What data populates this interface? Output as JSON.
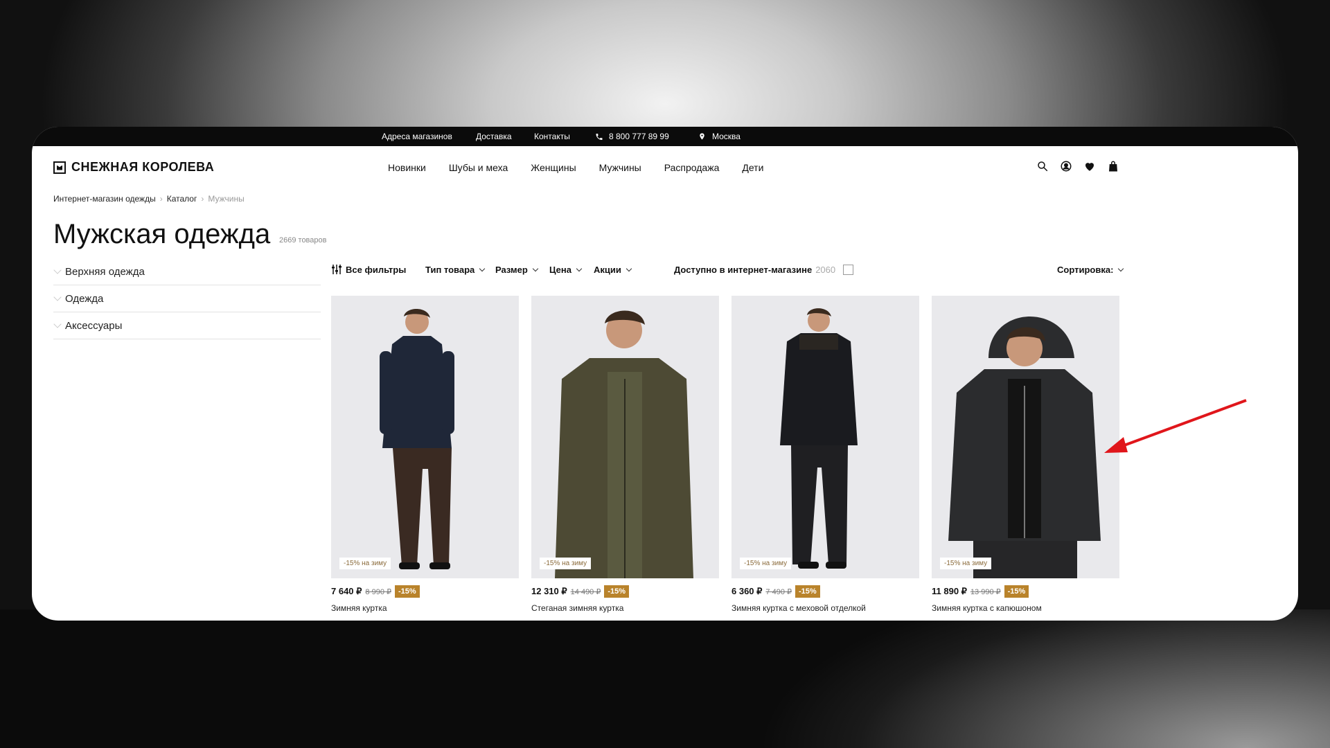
{
  "topbar": {
    "stores": "Адреса магазинов",
    "delivery": "Доставка",
    "contacts": "Контакты",
    "phone": "8 800 777 89 99",
    "city": "Москва"
  },
  "header": {
    "logo": "СНЕЖНАЯ КОРОЛЕВА",
    "nav": [
      "Новинки",
      "Шубы и меха",
      "Женщины",
      "Мужчины",
      "Распродажа",
      "Дети"
    ]
  },
  "breadcrumb": [
    "Интернет-магазин одежды",
    "Каталог",
    "Мужчины"
  ],
  "page": {
    "title": "Мужская одежда",
    "count": "2669 товаров"
  },
  "sidebar": {
    "items": [
      "Верхняя одежда",
      "Одежда",
      "Аксессуары"
    ]
  },
  "filters": {
    "all": "Все фильтры",
    "type": "Тип товара",
    "size": "Размер",
    "price": "Цена",
    "promos": "Акции",
    "available": "Доступно в интернет-магазине",
    "available_count": "2060",
    "sort": "Сортировка:"
  },
  "products": [
    {
      "badge": "-15% на зиму",
      "price": "7 640 ₽",
      "old_price": "8 990 ₽",
      "discount": "-15%",
      "name": "Зимняя куртка",
      "jacket_color": "#1f2738",
      "pants_color": "#3a2a22"
    },
    {
      "badge": "-15% на зиму",
      "price": "12 310 ₽",
      "old_price": "14 490 ₽",
      "discount": "-15%",
      "name": "Стеганая зимняя куртка",
      "jacket_color": "#4d4a34",
      "pants_color": "#2c2c2c"
    },
    {
      "badge": "-15% на зиму",
      "price": "6 360 ₽",
      "old_price": "7 490 ₽",
      "discount": "-15%",
      "name": "Зимняя куртка с меховой отделкой",
      "jacket_color": "#1a1b1f",
      "pants_color": "#1f1f22"
    },
    {
      "badge": "-15% на зиму",
      "price": "11 890 ₽",
      "old_price": "13 990 ₽",
      "discount": "-15%",
      "name": "Зимняя куртка с капюшоном",
      "jacket_color": "#2b2c2e",
      "pants_color": "#262628"
    }
  ],
  "colors": {
    "accent": "#b9832b",
    "annotation_arrow": "#e0161b"
  }
}
